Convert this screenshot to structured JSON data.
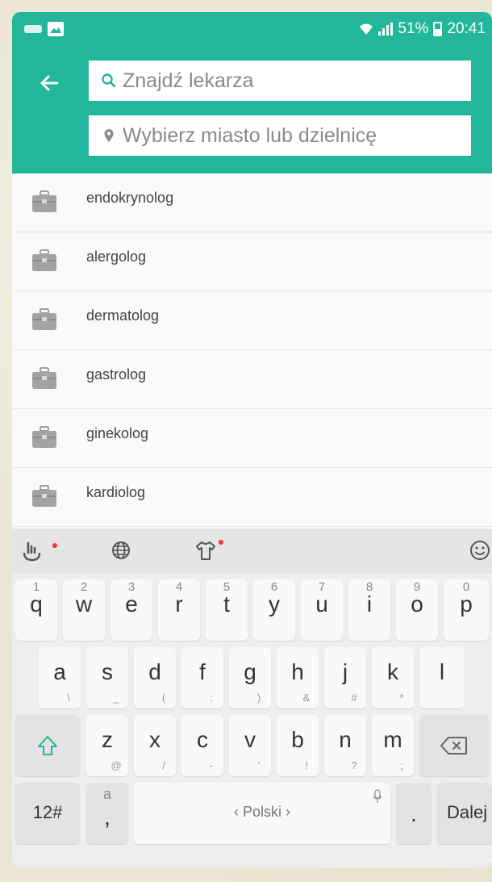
{
  "status_bar": {
    "battery": "51%",
    "time": "20:41"
  },
  "search": {
    "doctor_placeholder": "Znajdź lekarza",
    "city_placeholder": "Wybierz miasto lub dzielnicę"
  },
  "results": [
    {
      "label": "endokrynolog"
    },
    {
      "label": "alergolog"
    },
    {
      "label": "dermatolog"
    },
    {
      "label": "gastrolog"
    },
    {
      "label": "ginekolog"
    },
    {
      "label": "kardiolog"
    }
  ],
  "keyboard": {
    "row1": [
      {
        "key": "q",
        "hint": "1"
      },
      {
        "key": "w",
        "hint": "2"
      },
      {
        "key": "e",
        "hint": "3"
      },
      {
        "key": "r",
        "hint": "4"
      },
      {
        "key": "t",
        "hint": "5"
      },
      {
        "key": "y",
        "hint": "6"
      },
      {
        "key": "u",
        "hint": "7"
      },
      {
        "key": "i",
        "hint": "8"
      },
      {
        "key": "o",
        "hint": "9"
      },
      {
        "key": "p",
        "hint": "0"
      }
    ],
    "row2": [
      {
        "key": "a",
        "hint": "\\"
      },
      {
        "key": "s",
        "hint": "_"
      },
      {
        "key": "d",
        "hint": "("
      },
      {
        "key": "f",
        "hint": ":"
      },
      {
        "key": "g",
        "hint": ")"
      },
      {
        "key": "h",
        "hint": "&"
      },
      {
        "key": "j",
        "hint": "#"
      },
      {
        "key": "k",
        "hint": "*"
      },
      {
        "key": "l",
        "hint": ""
      }
    ],
    "row3": [
      {
        "key": "z",
        "hint": "@"
      },
      {
        "key": "x",
        "hint": "/"
      },
      {
        "key": "c",
        "hint": "-"
      },
      {
        "key": "v",
        "hint": "'"
      },
      {
        "key": "b",
        "hint": "!"
      },
      {
        "key": "n",
        "hint": "?"
      },
      {
        "key": "m",
        "hint": ";"
      }
    ],
    "numbers_key": "12#",
    "comma_key": ",",
    "comma_hint": "a",
    "space_label": "‹ Polski ›",
    "period_key": ".",
    "enter_key": "Dalej"
  },
  "colors": {
    "accent": "#22b69a",
    "notification_dot": "#e53935"
  }
}
